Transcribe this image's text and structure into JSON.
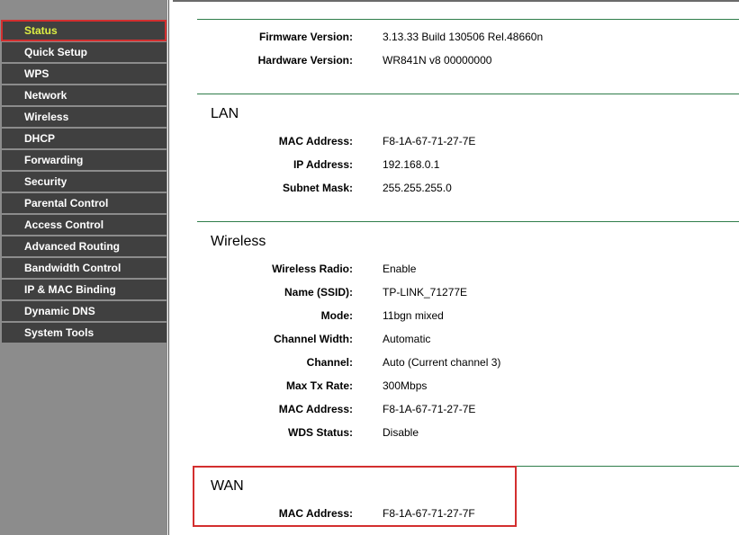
{
  "sidebar": {
    "items": [
      {
        "label": "Status"
      },
      {
        "label": "Quick Setup"
      },
      {
        "label": "WPS"
      },
      {
        "label": "Network"
      },
      {
        "label": "Wireless"
      },
      {
        "label": "DHCP"
      },
      {
        "label": "Forwarding"
      },
      {
        "label": "Security"
      },
      {
        "label": "Parental Control"
      },
      {
        "label": "Access Control"
      },
      {
        "label": "Advanced Routing"
      },
      {
        "label": "Bandwidth Control"
      },
      {
        "label": "IP & MAC Binding"
      },
      {
        "label": "Dynamic DNS"
      },
      {
        "label": "System Tools"
      }
    ],
    "active_color": "#ddee44"
  },
  "general": {
    "firmware_label": "Firmware Version:",
    "firmware_value": "3.13.33 Build 130506 Rel.48660n",
    "hardware_label": "Hardware Version:",
    "hardware_value": "WR841N v8 00000000"
  },
  "lan": {
    "title": "LAN",
    "mac_label": "MAC Address:",
    "mac_value": "F8-1A-67-71-27-7E",
    "ip_label": "IP Address:",
    "ip_value": "192.168.0.1",
    "subnet_label": "Subnet Mask:",
    "subnet_value": "255.255.255.0"
  },
  "wireless": {
    "title": "Wireless",
    "radio_label": "Wireless Radio:",
    "radio_value": "Enable",
    "ssid_label": "Name (SSID):",
    "ssid_value": "TP-LINK_71277E",
    "mode_label": "Mode:",
    "mode_value": "11bgn mixed",
    "width_label": "Channel Width:",
    "width_value": "Automatic",
    "channel_label": "Channel:",
    "channel_value": "Auto (Current channel 3)",
    "rate_label": "Max Tx Rate:",
    "rate_value": "300Mbps",
    "mac_label": "MAC Address:",
    "mac_value": "F8-1A-67-71-27-7E",
    "wds_label": "WDS Status:",
    "wds_value": "Disable"
  },
  "wan": {
    "title": "WAN",
    "mac_label": "MAC Address:",
    "mac_value": "F8-1A-67-71-27-7F"
  },
  "colors": {
    "sidebar_bg": "#8c8c8c",
    "menu_bg": "#404040",
    "section_rule": "#2f7d4a",
    "highlight": "#d32f2f"
  }
}
